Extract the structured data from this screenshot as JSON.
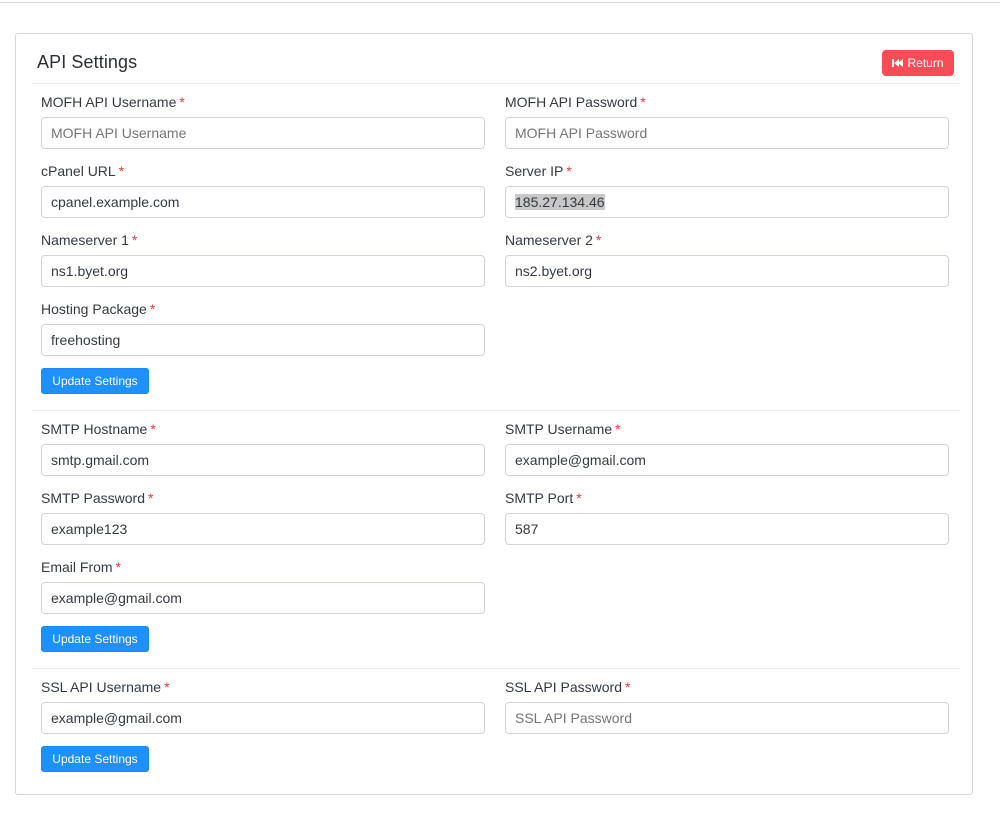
{
  "header": {
    "title": "API Settings",
    "return_label": "Return",
    "return_icon": "fast-backward-icon"
  },
  "colors": {
    "danger": "#f94c56",
    "primary": "#1e90ff",
    "required": "#e0383e"
  },
  "required_mark": "*",
  "mofh": {
    "username": {
      "label": "MOFH API Username",
      "placeholder": "MOFH API Username"
    },
    "password": {
      "label": "MOFH API Password",
      "placeholder": "MOFH API Password"
    },
    "cpanel_url": {
      "label": "cPanel URL",
      "value": "cpanel.example.com"
    },
    "server_ip": {
      "label": "Server IP",
      "value": "185.27.134.46"
    },
    "ns1": {
      "label": "Nameserver 1",
      "value": "ns1.byet.org"
    },
    "ns2": {
      "label": "Nameserver 2",
      "value": "ns2.byet.org"
    },
    "package": {
      "label": "Hosting Package",
      "value": "freehosting"
    },
    "submit_label": "Update Settings"
  },
  "smtp": {
    "hostname": {
      "label": "SMTP Hostname",
      "value": "smtp.gmail.com"
    },
    "username": {
      "label": "SMTP Username",
      "value": "example@gmail.com"
    },
    "password": {
      "label": "SMTP Password",
      "value": "example123"
    },
    "port": {
      "label": "SMTP Port",
      "value": "587"
    },
    "email_from": {
      "label": "Email From",
      "value": "example@gmail.com"
    },
    "submit_label": "Update Settings"
  },
  "ssl": {
    "username": {
      "label": "SSL API Username",
      "value": "example@gmail.com"
    },
    "password": {
      "label": "SSL API Password",
      "placeholder": "SSL API Password"
    },
    "submit_label": "Update Settings"
  }
}
